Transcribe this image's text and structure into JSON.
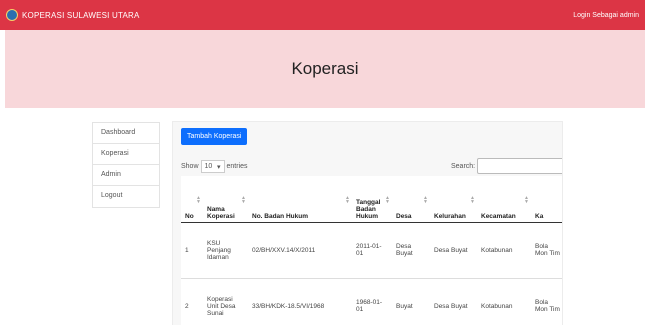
{
  "navbar": {
    "brand": "KOPERASI SULAWESI UTARA",
    "user_text": "Login Sebagai admin"
  },
  "hero": {
    "title": "Koperasi"
  },
  "sidebar": {
    "items": [
      {
        "label": "Dashboard"
      },
      {
        "label": "Koperasi"
      },
      {
        "label": "Admin"
      },
      {
        "label": "Logout"
      }
    ]
  },
  "toolbar": {
    "add_label": "Tambah Koperasi"
  },
  "controls": {
    "show_label": "Show",
    "show_value": "10",
    "entries_label": "entries",
    "search_label": "Search:"
  },
  "table": {
    "headers": [
      "No",
      "Nama Koperasi",
      "No. Badan Hukum",
      "Tanggal Badan Hukum",
      "Desa",
      "Kelurahan",
      "Kecamatan",
      "Ka"
    ],
    "rows": [
      [
        "1",
        "KSU Penjang Idaman",
        "02/BH/XXV.14/X/2011",
        "2011-01-01",
        "Desa Buyat",
        "Desa Buyat",
        "Kotabunan",
        "Bola Mon Tim"
      ],
      [
        "2",
        "Koperasi Unit Desa Sunai",
        "33/BH/KDK-18.5/VI/1968",
        "1968-01-01",
        "Buyat",
        "Desa Buyat",
        "Kotabunan",
        "Bola Mon Tim"
      ]
    ]
  }
}
